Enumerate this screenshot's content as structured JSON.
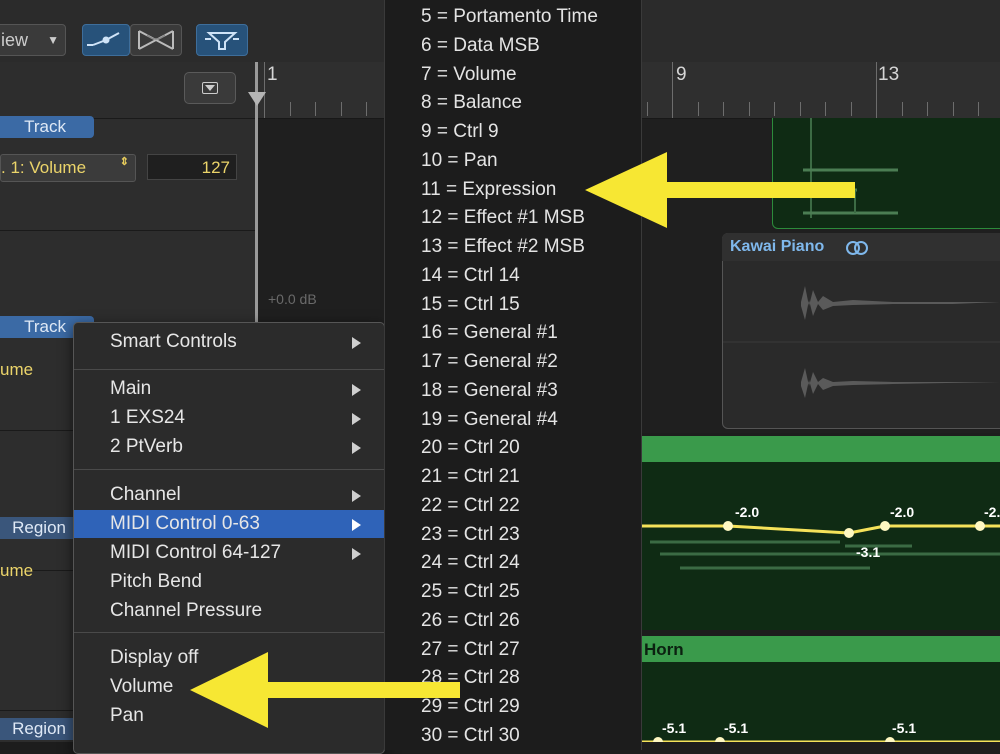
{
  "toolbar": {
    "view_label": "iew",
    "view_chevron": "▼",
    "tools": [
      "automation-curve-tool",
      "crossfade-tool",
      "filter-tool"
    ]
  },
  "inspector": {
    "track_label_1": "Track",
    "param_select": ". 1: Volume",
    "param_select_chevron": "⇕",
    "value": "127",
    "track_label_2": "Track",
    "param_2": "ume",
    "region_label_1": "Region",
    "param_3": "ume",
    "region_label_2": "Region"
  },
  "ruler": {
    "bar_numbers": [
      "1",
      "9",
      "13"
    ]
  },
  "tracks": {
    "db_label": "+0.0 dB",
    "kawai_title": "Kawai Piano",
    "horn_title": "Horn",
    "automation_points_upper": [
      "-2.0",
      "-2.0",
      "-2.",
      "-3.1"
    ],
    "automation_points_lower": [
      "-5.1",
      "-5.1",
      "-5.1"
    ]
  },
  "context_menu": {
    "groups": [
      [
        {
          "label": "Smart Controls",
          "submenu": true
        }
      ],
      [
        {
          "label": "Main",
          "submenu": true
        },
        {
          "label": "1 EXS24",
          "submenu": true
        },
        {
          "label": "2 PtVerb",
          "submenu": true
        }
      ],
      [
        {
          "label": "Channel",
          "submenu": true
        },
        {
          "label": "MIDI Control 0-63",
          "submenu": true,
          "selected": true
        },
        {
          "label": "MIDI Control 64-127",
          "submenu": true
        },
        {
          "label": "Pitch Bend",
          "submenu": false
        },
        {
          "label": "Channel Pressure",
          "submenu": false
        }
      ],
      [
        {
          "label": "Display off",
          "submenu": false
        },
        {
          "label": "Volume",
          "submenu": false
        },
        {
          "label": "Pan",
          "submenu": false
        }
      ]
    ]
  },
  "submenu": {
    "items": [
      "5 = Portamento Time",
      "6 = Data MSB",
      "7 = Volume",
      "8 = Balance",
      "9 = Ctrl 9",
      "10 = Pan",
      "11 = Expression",
      "12 = Effect #1 MSB",
      "13 = Effect #2 MSB",
      "14 = Ctrl 14",
      "15 = Ctrl 15",
      "16 = General #1",
      "17 = General #2",
      "18 = General #3",
      "19 = General #4",
      "20 = Ctrl 20",
      "21 = Ctrl 21",
      "22 = Ctrl 22",
      "23 = Ctrl 23",
      "24 = Ctrl 24",
      "25 = Ctrl 25",
      "26 = Ctrl 26",
      "27 = Ctrl 27",
      "28 = Ctrl 28",
      "29 = Ctrl 29",
      "30 = Ctrl 30"
    ]
  },
  "colors": {
    "arrow": "#f7e733",
    "selection": "#2f63b8",
    "region_green": "#3a9a4b",
    "param_yellow": "#ebd46a"
  }
}
